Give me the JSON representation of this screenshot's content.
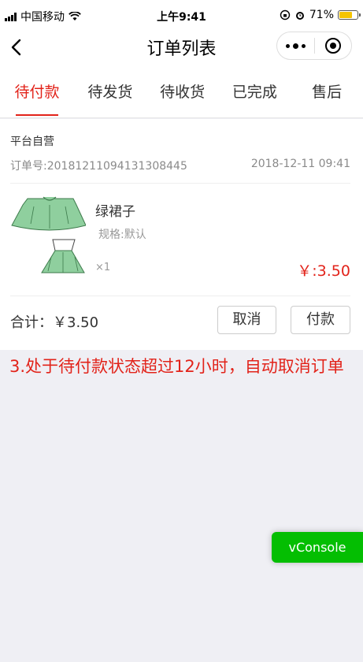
{
  "status_bar": {
    "carrier": "中国移动",
    "time": "上午9:41",
    "battery_percent": "71%",
    "battery_level": 0.71
  },
  "nav": {
    "title": "订单列表"
  },
  "tabs": [
    {
      "label": "待付款",
      "active": true
    },
    {
      "label": "待发货",
      "active": false
    },
    {
      "label": "待收货",
      "active": false
    },
    {
      "label": "已完成",
      "active": false
    },
    {
      "label": "售后",
      "active": false
    }
  ],
  "order": {
    "shop_name": "平台自营",
    "order_no": "订单号:20181211094131308445",
    "time": "2018-12-11 09:41",
    "product": {
      "name": "绿裙子",
      "spec": "规格:默认",
      "qty": "×1",
      "price": "￥:3.50"
    },
    "total": "合计：￥3.50",
    "cancel_label": "取消",
    "pay_label": "付款"
  },
  "note": "3.处于待付款状态超过12小时，自动取消订单",
  "vconsole_label": "vConsole",
  "colors": {
    "accent": "#e2231a",
    "vconsole": "#04be02",
    "background": "#efeff4"
  }
}
